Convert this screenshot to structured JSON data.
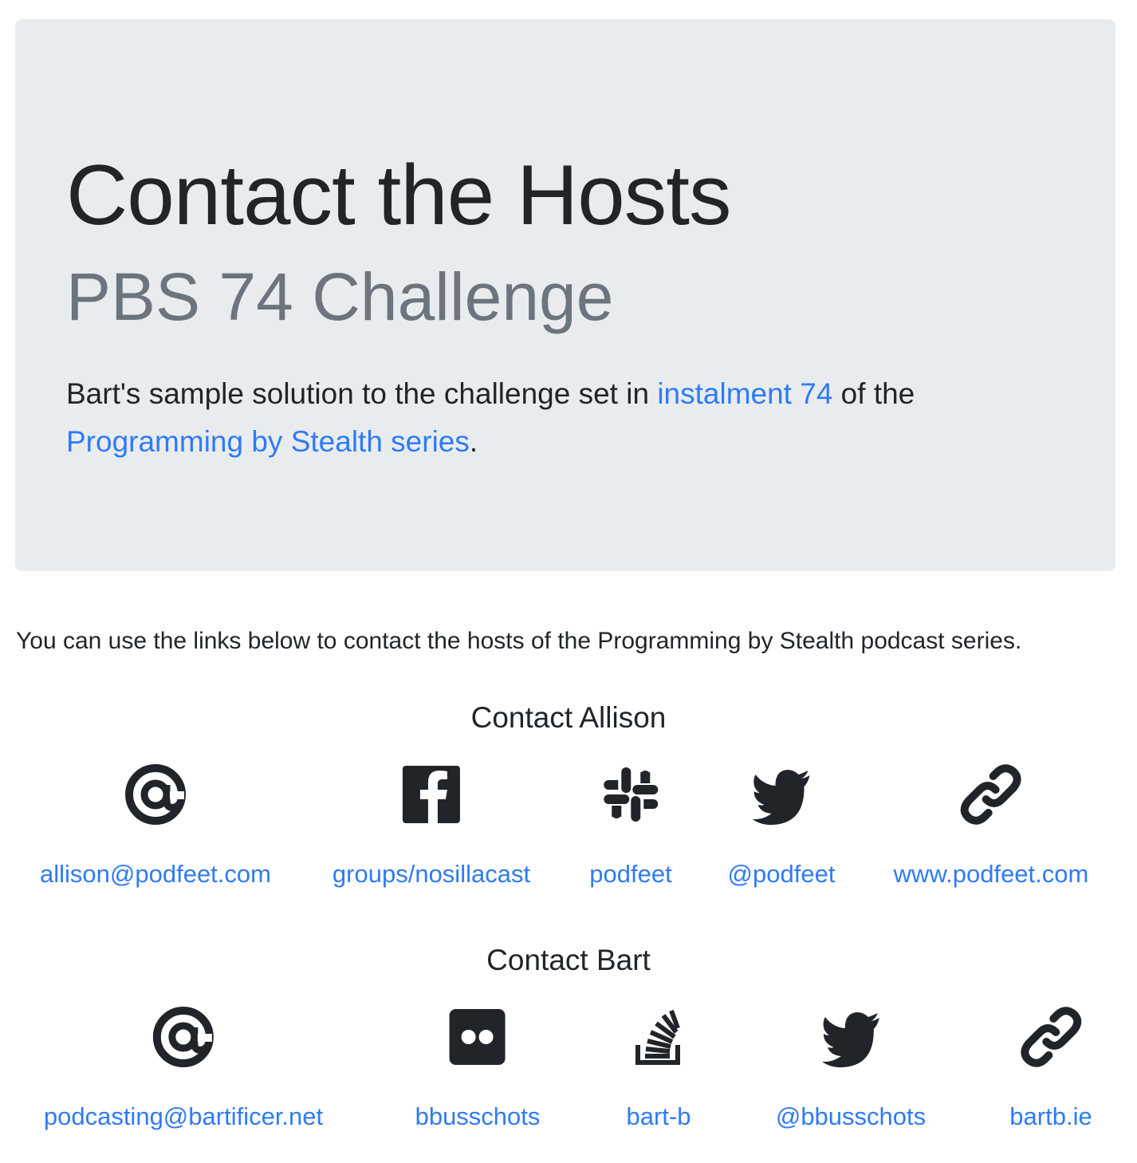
{
  "jumbotron": {
    "title": "Contact the Hosts",
    "subtitle": "PBS 74 Challenge",
    "lead_before": "Bart's sample solution to the challenge set in ",
    "lead_link1": "instalment 74",
    "lead_middle": " of the ",
    "lead_link2": "Programming by Stealth series",
    "lead_after": "."
  },
  "intro": "You can use the links below to contact the hosts of the Programming by Stealth podcast series.",
  "allison": {
    "heading": "Contact Allison",
    "contacts": [
      {
        "icon": "at-icon",
        "label": "allison@podfeet.com"
      },
      {
        "icon": "facebook-icon",
        "label": "groups/nosillacast"
      },
      {
        "icon": "slack-icon",
        "label": "podfeet"
      },
      {
        "icon": "twitter-icon",
        "label": "@podfeet"
      },
      {
        "icon": "link-icon",
        "label": "www.podfeet.com"
      }
    ]
  },
  "bart": {
    "heading": "Contact Bart",
    "contacts": [
      {
        "icon": "at-icon",
        "label": "podcasting@bartificer.net"
      },
      {
        "icon": "flickr-icon",
        "label": "bbusschots"
      },
      {
        "icon": "stackoverflow-icon",
        "label": "bart-b"
      },
      {
        "icon": "twitter-icon",
        "label": "@bbusschots"
      },
      {
        "icon": "link-icon",
        "label": "bartb.ie"
      }
    ]
  },
  "colors": {
    "link": "#2f7bf5",
    "jumbotron_bg": "#e9ecef",
    "subtitle": "#6c757d",
    "text": "#212529"
  }
}
